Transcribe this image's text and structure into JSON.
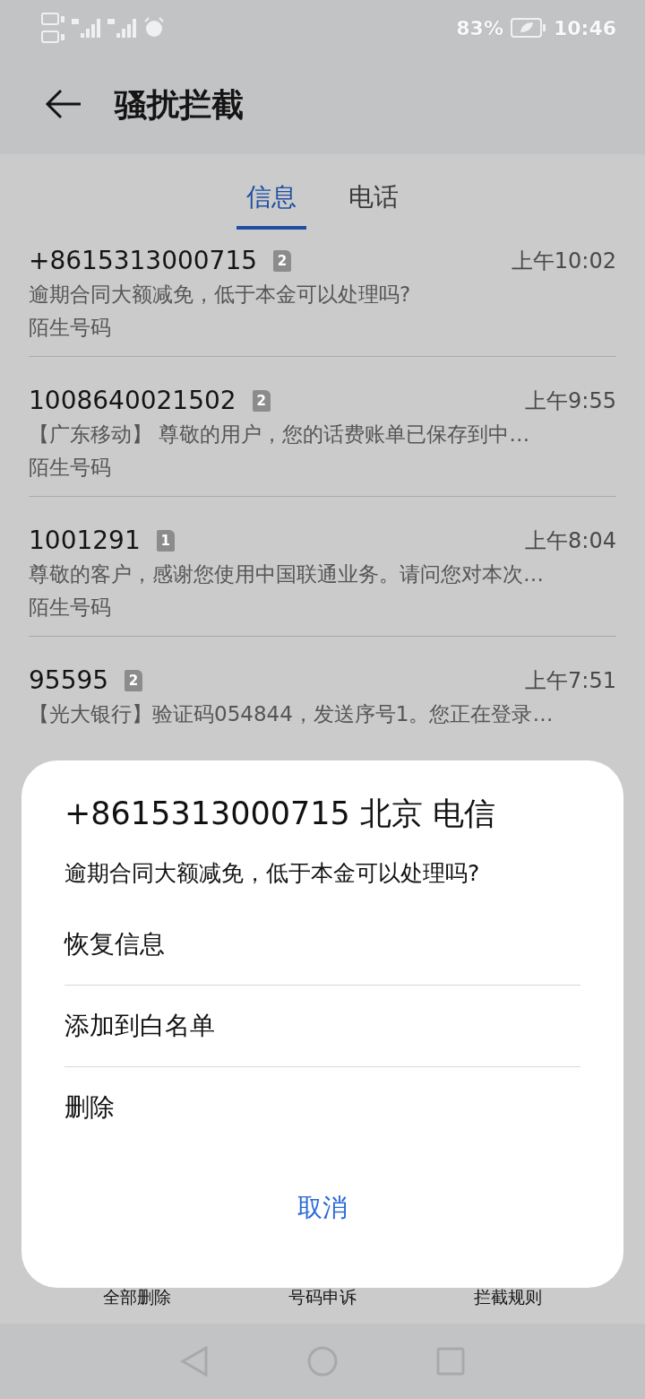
{
  "status_bar": {
    "battery": "83%",
    "time": "10:46"
  },
  "header": {
    "title": "骚扰拦截"
  },
  "tabs": [
    {
      "label": "信息",
      "selected": true
    },
    {
      "label": "电话",
      "selected": false
    }
  ],
  "messages": [
    {
      "sender": "+8615313000715",
      "sim": "2",
      "time": "上午10:02",
      "preview": "逾期合同大额减免，低于本金可以处理吗?",
      "tag": "陌生号码"
    },
    {
      "sender": "1008640021502",
      "sim": "2",
      "time": "上午9:55",
      "preview": "【广东移动】 尊敬的用户，您的话费账单已保存到中…",
      "tag": "陌生号码"
    },
    {
      "sender": "1001291",
      "sim": "1",
      "time": "上午8:04",
      "preview": "尊敬的客户，感谢您使用中国联通业务。请问您对本次…",
      "tag": "陌生号码"
    },
    {
      "sender": "95595",
      "sim": "2",
      "time": "上午7:51",
      "preview": "【光大银行】验证码054844，发送序号1。您正在登录…"
    }
  ],
  "bottom_bar": [
    "全部删除",
    "号码申诉",
    "拦截规则"
  ],
  "dialog": {
    "title": "+8615313000715 北京 电信",
    "message": "逾期合同大额减免，低于本金可以处理吗?",
    "options": [
      "恢复信息",
      "添加到白名单",
      "删除"
    ],
    "cancel": "取消"
  }
}
